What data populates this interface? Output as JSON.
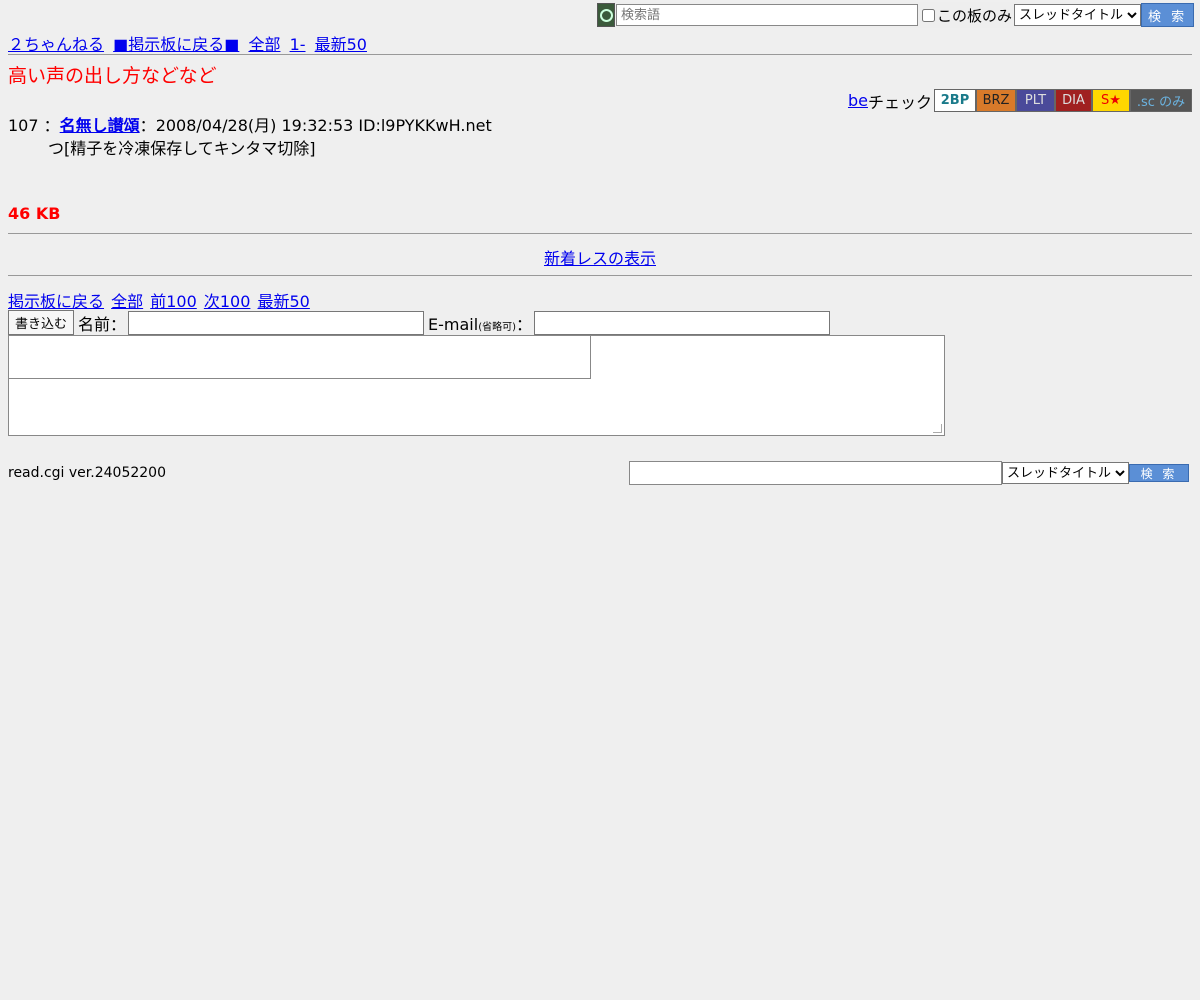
{
  "search_top": {
    "placeholder": "検索語",
    "board_only_label": "この板のみ",
    "select_value": "スレッドタイトル",
    "button_label": "検 索"
  },
  "nav": {
    "home": "２ちゃんねる",
    "back_board": "■掲示板に戻る■",
    "all": "全部",
    "from1": "1-",
    "latest50": "最新50"
  },
  "thread_title": "高い声の出し方などなど",
  "be_check": {
    "link": "be",
    "suffix": "チェック",
    "tags": [
      "2BP",
      "BRZ",
      "PLT",
      "DIA",
      "S★",
      ".sc のみ"
    ]
  },
  "post": {
    "number": "107",
    "sep": "：",
    "name": "名無し讃頌",
    "sep2": "：",
    "date": "2008/04/28(月) 19:32:53 ID:l9PYKKwH.net",
    "body": "つ[精子を冷凍保存してキンタマ切除]"
  },
  "size": "46 KB",
  "new_responses": "新着レスの表示",
  "bottom_nav": {
    "back": "掲示板に戻る",
    "all": "全部",
    "prev": "前100",
    "next": "次100",
    "latest": "最新50"
  },
  "form": {
    "write_button": "書き込む",
    "name_label": "名前：",
    "email_label": "E-mail",
    "email_hint": "(省略可)",
    "email_colon": "："
  },
  "footer": {
    "version": "read.cgi ver.24052200"
  },
  "search_bottom": {
    "select_value": "スレッドタイトル",
    "button_label": "検 索"
  }
}
